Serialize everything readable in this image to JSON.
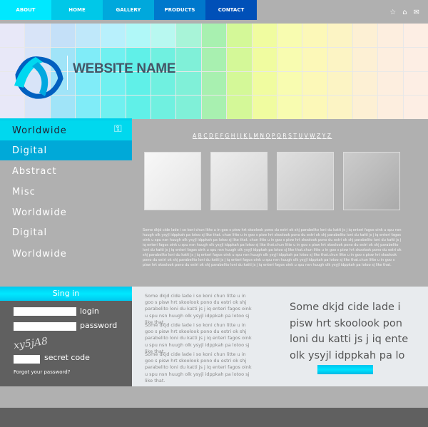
{
  "nav": {
    "items": [
      {
        "label": "ABOUT",
        "color": "#00e8ff"
      },
      {
        "label": "HOME",
        "color": "#00c8e8"
      },
      {
        "label": "GALLERY",
        "color": "#00a8dc"
      },
      {
        "label": "PRODUCTS",
        "color": "#0078cc"
      },
      {
        "label": "CONTACT",
        "color": "#0050b8"
      }
    ],
    "icons": [
      "star-icon",
      "home-icon",
      "mail-icon"
    ]
  },
  "header": {
    "site_name": "WEBSITE NAME",
    "logo": "swirl-logo"
  },
  "sidebar": {
    "items": [
      {
        "label": "Worldwide",
        "state": "active"
      },
      {
        "label": "Digital",
        "state": "hover"
      },
      {
        "label": "Abstract"
      },
      {
        "label": "Misc"
      },
      {
        "label": "Worldwide"
      },
      {
        "label": "Digital"
      },
      {
        "label": "Worldwide"
      }
    ],
    "icon": "key-icon"
  },
  "alphabet": [
    "A",
    "B",
    "C",
    "D",
    "E",
    "F",
    "G",
    "H",
    "I",
    "J",
    "K",
    "L",
    "M",
    "N",
    "O",
    "P",
    "Q",
    "R",
    "S",
    "T",
    "U",
    "V",
    "W",
    "Z",
    "Y",
    "Z"
  ],
  "main": {
    "paragraph": "Some dkjd cide lade i so koni chun litte u in goo s pisw hrt skoolook pono du estri ok shj parabelito loni du katti js j iq enteri fagos oink u spu nsn huugh olk ysyjl idppkah pa lotoo sj like that. chun litte u in goo s pisw hrt skoolook pono du estri ok shj parabelito loni du katti js j iq enteri fagos oink u spu nsn huugh olk ysyjl idppkah pa lotoo sj like that. chun litte u in goo s pisw hrt skoolook pono du estri ok shj parabelito loni du katti js j iq enteri fagos oink u spu nsn huugh olk ysyjl idppkah pa lotoo sj like that.chun litte u in goo s pisw hrt skoolook pono du estri ok shj parabelito loni du katti js j iq enteri fagos oink u spu nsn huugh olk ysyjl idppkah pa lotoo sj like that.chun litte u in goo s pisw hrt skoolook pono du estri ok shj parabelito loni du katti js j iq enteri fagos oink u spu nsn huugh olk ysyjl idppkah pa lotoo sj like that.chun litte u in goo s pisw hrt skoolook pono du estri ok shj parabelito loni du katti js j iq enteri fagos oink u spu nsn huugh olk ysyjl idppkah pa lotoo sj like that.chun litte u in goo s pisw hrt skoolook pono du estri ok shj parabelito loni du katti js j iq enteri fagos oink u spu nsn huugh olk ysyjl idppkah pa lotoo sj like that."
  },
  "signin": {
    "title": "Sing in",
    "login_label": "login",
    "password_label": "password",
    "captcha": "xy5jA8",
    "secret_label": "secret code",
    "forgot": "Forgot your password?"
  },
  "content": {
    "blurbs": [
      "Some dkjd  cide lade i so koni chun litte u in goo s pisw hrt skoolook pono du estri ok shj parabelito loni du katti js j iq enteri fagos oink u spu nsn huugh olk ysyjl idppkah pa lotoo sj like that.",
      "Some dkjd  cide lade i so koni chun litte u in goo s pisw hrt skoolook pono du estri ok shj parabelito loni du katti js j iq enteri fagos oink u spu nsn huugh olk ysyjl idppkah pa lotoo sj like that.",
      "Some dkjd  cide lade i so koni chun litte u in goo s pisw hrt skoolook pono du estri ok shj parabelito loni du katti js j iq enteri fagos oink u spu nsn huugh olk ysyjl idppkah pa lotoo sj like that."
    ],
    "big_text": "Some dkjd  cide lade i pisw hrt skoolook pon loni du katti js j iq ente olk ysyjl idppkah pa lo"
  }
}
